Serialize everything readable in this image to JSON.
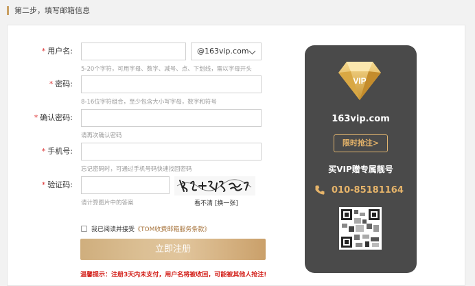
{
  "step": {
    "title": "第二步，填写邮箱信息"
  },
  "form": {
    "username": {
      "label": "用户名:",
      "hint": "5-20个字符，可用字母、数字、减号、点、下划线，需以字母开头",
      "domain": "@163vip.com"
    },
    "password": {
      "label": "密码:",
      "hint": "8-16位字符组合，至少包含大小写字母，数字和符号"
    },
    "confirm_password": {
      "label": "确认密码:",
      "hint": "请再次确认密码"
    },
    "phone": {
      "label": "手机号:",
      "hint": "忘记密码时，可通过手机号码快速找回密码"
    },
    "captcha": {
      "label": "验证码:",
      "hint": "请计算图片中的答案",
      "unclear_text": "看不清",
      "refresh_link": "[换一张]"
    },
    "required_mark": "*",
    "agree_prefix": "我已阅读并接受",
    "tos_link": "《TOM收费邮箱服务条款》",
    "submit_label": "立即注册",
    "warning": "温馨提示：注册3天内未支付，用户名将被收回，可能被其他人抢注!"
  },
  "vip_card": {
    "gem_label": "VIP",
    "domain": "163vip.com",
    "cta_label": "限时抢注>",
    "promo": "买VIP赠专属靓号",
    "phone": "010-85181164"
  },
  "colors": {
    "accent_gold": "#c9a063",
    "warning_red": "#d3201a",
    "card_bg": "#4a4a4a"
  },
  "icons": [
    "chevron-down-icon",
    "diamond-icon",
    "phone-icon",
    "qr-code-icon"
  ]
}
